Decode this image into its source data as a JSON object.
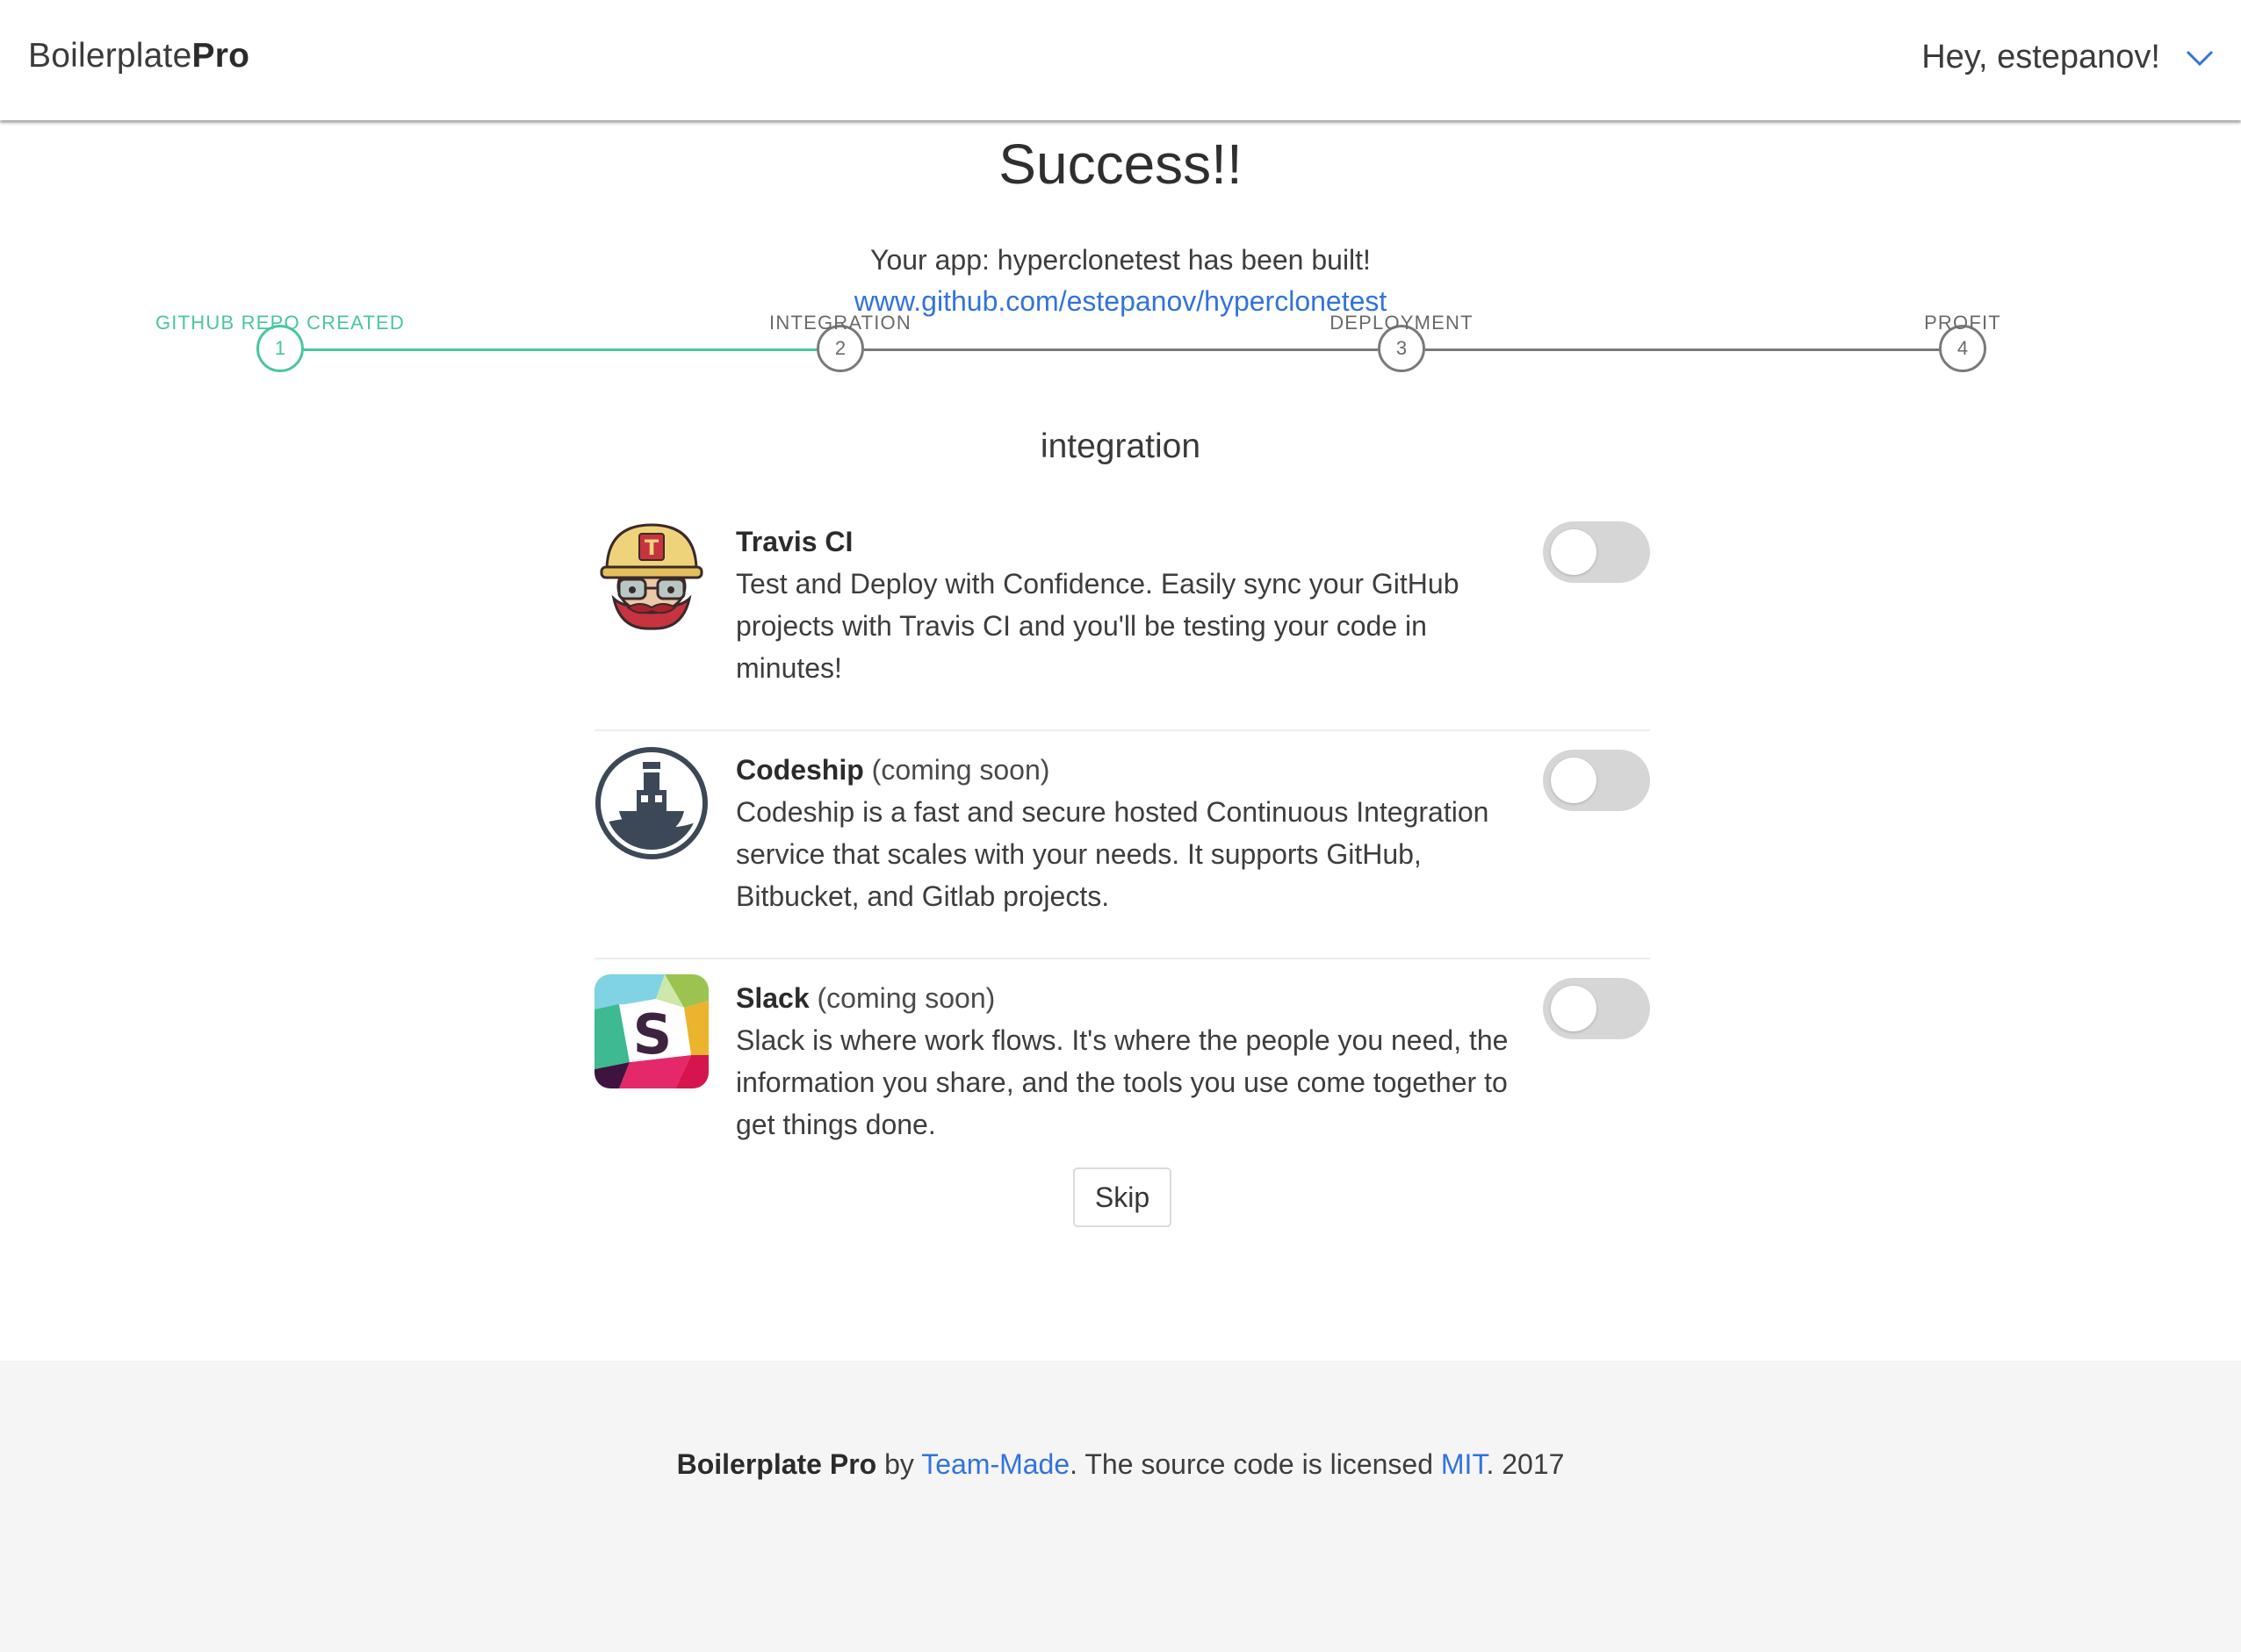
{
  "navbar": {
    "brand_light": "Boilerplate",
    "brand_bold": "Pro",
    "greeting": "Hey, estepanov!",
    "dropdown_icon": "chevron-down-icon"
  },
  "hero": {
    "title": "Success!!",
    "message": "Your app: hyperclonetest has been built!",
    "repo_link": "www.github.com/estepanov/hyperclonetest"
  },
  "steps": [
    {
      "number": "1",
      "label": "GITHUB REPO CREATED",
      "done": true
    },
    {
      "number": "2",
      "label": "INTEGRATION",
      "done": false
    },
    {
      "number": "3",
      "label": "DEPLOYMENT",
      "done": false
    },
    {
      "number": "4",
      "label": "PROFIT",
      "done": false
    }
  ],
  "section_title": "integration",
  "integrations": [
    {
      "name": "Travis CI",
      "note": "",
      "description": "Test and Deploy with Confidence. Easily sync your GitHub projects with Travis CI and you'll be testing your code in minutes!",
      "icon": "travis-ci-logo-icon",
      "enabled": false
    },
    {
      "name": "Codeship",
      "note": "(coming soon)",
      "description": "Codeship is a fast and secure hosted Continuous Integration service that scales with your needs. It supports GitHub, Bitbucket, and Gitlab projects.",
      "icon": "codeship-logo-icon",
      "enabled": false
    },
    {
      "name": "Slack",
      "note": "(coming soon)",
      "description": "Slack is where work flows. It's where the people you need, the information you share, and the tools you use come together to get things done.",
      "icon": "slack-logo-icon",
      "enabled": false
    }
  ],
  "skip_label": "Skip",
  "footer": {
    "brand": "Boilerplate Pro",
    "by": " by ",
    "team": "Team-Made",
    "licensed": ". The source code is licensed ",
    "license": "MIT",
    "year": ". 2017"
  },
  "colors": {
    "accent_green": "#48c79a",
    "link_blue": "#3273dc",
    "toggle_off": "#d6d6d6",
    "footer_bg": "#f5f5f5"
  }
}
